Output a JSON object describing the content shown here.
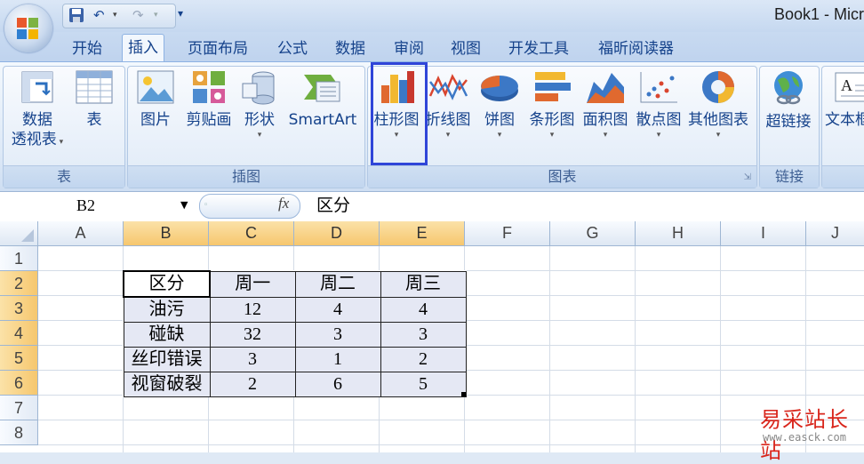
{
  "window": {
    "title": "Book1 - Micr"
  },
  "qat": {
    "more": "▾"
  },
  "tabs": [
    {
      "label": "开始"
    },
    {
      "label": "插入"
    },
    {
      "label": "页面布局"
    },
    {
      "label": "公式"
    },
    {
      "label": "数据"
    },
    {
      "label": "审阅"
    },
    {
      "label": "视图"
    },
    {
      "label": "开发工具"
    },
    {
      "label": "福昕阅读器"
    }
  ],
  "ribbon": {
    "groups": {
      "tables": "表",
      "illustrations": "插图",
      "charts": "图表",
      "links": "链接"
    },
    "buttons": {
      "pivot_line1": "数据",
      "pivot_line2": "透视表",
      "table": "表",
      "picture": "图片",
      "clipart": "剪贴画",
      "shapes": "形状",
      "smartart": "SmartArt",
      "column": "柱形图",
      "line": "折线图",
      "pie": "饼图",
      "bar": "条形图",
      "area": "面积图",
      "scatter": "散点图",
      "other": "其他图表",
      "hyperlink": "超链接",
      "textbox": "文本框"
    }
  },
  "formula_bar": {
    "name_box": "B2",
    "fx": "fx",
    "content": "区分"
  },
  "grid": {
    "columns": [
      "A",
      "B",
      "C",
      "D",
      "E",
      "F",
      "G",
      "H",
      "I",
      "J"
    ],
    "rows": [
      "1",
      "2",
      "3",
      "4",
      "5",
      "6",
      "7",
      "8"
    ],
    "table": [
      [
        "区分",
        "周一",
        "周二",
        "周三"
      ],
      [
        "油污",
        "12",
        "4",
        "4"
      ],
      [
        "碰缺",
        "32",
        "3",
        "3"
      ],
      [
        "丝印错误",
        "3",
        "1",
        "2"
      ],
      [
        "视窗破裂",
        "2",
        "6",
        "5"
      ]
    ]
  },
  "watermark": {
    "text": "易采站长站",
    "url": "www.easck.com"
  },
  "colors": {
    "highlight_box": "#2f45d8",
    "selected_header": "#f6c76e",
    "ribbon_text": "#15428b"
  }
}
